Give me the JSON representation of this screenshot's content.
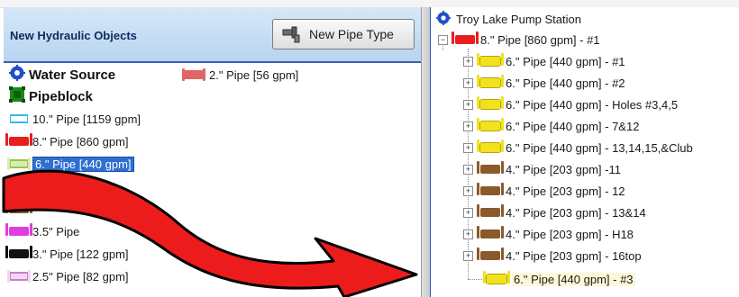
{
  "left_panel": {
    "title": "New Hydraulic Objects",
    "new_pipe_button": "New Pipe Type",
    "items": [
      {
        "label": "Water Source",
        "icon": "gear-icon",
        "color": "#1f4fc6",
        "bold": true
      },
      {
        "label": "Pipeblock",
        "icon": "pipeblock-icon",
        "color": "#178a17",
        "bold": true
      },
      {
        "label": "10.\" Pipe [1159 gpm]",
        "icon": "pipe-icon",
        "color": "#39b6ea"
      },
      {
        "label": "8.\" Pipe [860 gpm]",
        "icon": "pipe-icon",
        "color": "#e81e1e"
      },
      {
        "label": "6.\" Pipe [440 gpm]",
        "icon": "pipe-icon",
        "color": "#9bc44a",
        "selected": true
      },
      {
        "label": "",
        "icon": "pipe-icon",
        "color": "#1f8a1f"
      },
      {
        "label": "",
        "icon": "pipe-icon",
        "color": "#8b5a2b"
      },
      {
        "label": "3.5\" Pipe",
        "icon": "pipe-icon",
        "color": "#e03ce0"
      },
      {
        "label": "3.\" Pipe [122 gpm]",
        "icon": "pipe-icon",
        "color": "#111111"
      },
      {
        "label": "2.5\" Pipe [82 gpm]",
        "icon": "pipe-icon",
        "color": "#e3a6e3"
      }
    ],
    "extra_item": {
      "label": "2.\" Pipe [56 gpm]",
      "icon": "pipe-icon",
      "color": "#e06666"
    }
  },
  "tree": {
    "root": {
      "label": "Troy Lake Pump Station",
      "icon": "gear-icon",
      "color": "#1f4fc6"
    },
    "main_pipe": {
      "label": "8.\" Pipe [860 gpm] - #1",
      "color": "#e81e1e",
      "expander": "−"
    },
    "children": [
      {
        "label": "6.\" Pipe [440 gpm] - #1",
        "color": "#f2e21c"
      },
      {
        "label": "6.\" Pipe [440 gpm] - #2",
        "color": "#f2e21c"
      },
      {
        "label": "6.\" Pipe [440 gpm] - Holes #3,4,5",
        "color": "#f2e21c"
      },
      {
        "label": "6.\" Pipe [440 gpm] - 7&12",
        "color": "#f2e21c"
      },
      {
        "label": "6.\" Pipe [440 gpm] - 13,14,15,&Club",
        "color": "#f2e21c"
      },
      {
        "label": "4.\" Pipe [203 gpm] -11",
        "color": "#8b5a2b"
      },
      {
        "label": "4.\" Pipe [203 gpm] - 12",
        "color": "#8b5a2b"
      },
      {
        "label": "4.\" Pipe [203 gpm] - 13&14",
        "color": "#8b5a2b"
      },
      {
        "label": "4.\" Pipe [203 gpm] - H18",
        "color": "#8b5a2b"
      },
      {
        "label": "4.\" Pipe [203 gpm] - 16top",
        "color": "#8b5a2b"
      },
      {
        "label": "6.\" Pipe [440 gpm] - #3",
        "color": "#f2e21c",
        "no_expander": true,
        "highlight": true
      }
    ],
    "expander_plus": "+"
  },
  "arrow": {
    "fill": "#ec1c1c",
    "stroke": "#000000",
    "meaning": "drag item into tree"
  }
}
